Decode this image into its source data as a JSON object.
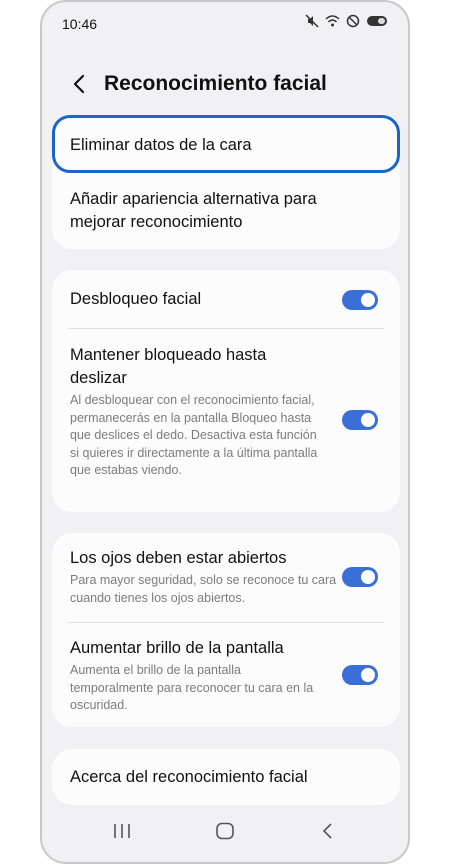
{
  "status_bar": {
    "time": "10:46"
  },
  "header": {
    "title": "Reconocimiento facial"
  },
  "card1": {
    "delete_face": "Eliminar datos de la cara",
    "add_alt_appearance": "Añadir apariencia alternativa para mejorar reconocimiento"
  },
  "card2": {
    "face_unlock": {
      "title": "Desbloqueo facial",
      "enabled": true
    },
    "stay_locked": {
      "title": "Mantener bloqueado hasta deslizar",
      "description": "Al desbloquear con el reconocimiento facial, permanecerás en la pantalla Bloqueo hasta que deslices el dedo. Desactiva esta función si quieres ir directamente a la última pantalla que estabas viendo.",
      "enabled": true
    }
  },
  "card3": {
    "eyes_open": {
      "title": "Los ojos deben estar abiertos",
      "description": "Para mayor seguridad, solo se reconoce tu cara cuando tienes los ojos abiertos.",
      "enabled": true
    },
    "brightness": {
      "title": "Aumentar brillo de la pantalla",
      "description": "Aumenta el brillo de la pantalla temporalmente para reconocer tu cara en la oscuridad.",
      "enabled": true
    }
  },
  "card4": {
    "about": "Acerca del reconocimiento facial"
  },
  "colors": {
    "accent": "#3b6fd8",
    "highlight": "#1b64c8",
    "background": "#f1f1f3"
  }
}
